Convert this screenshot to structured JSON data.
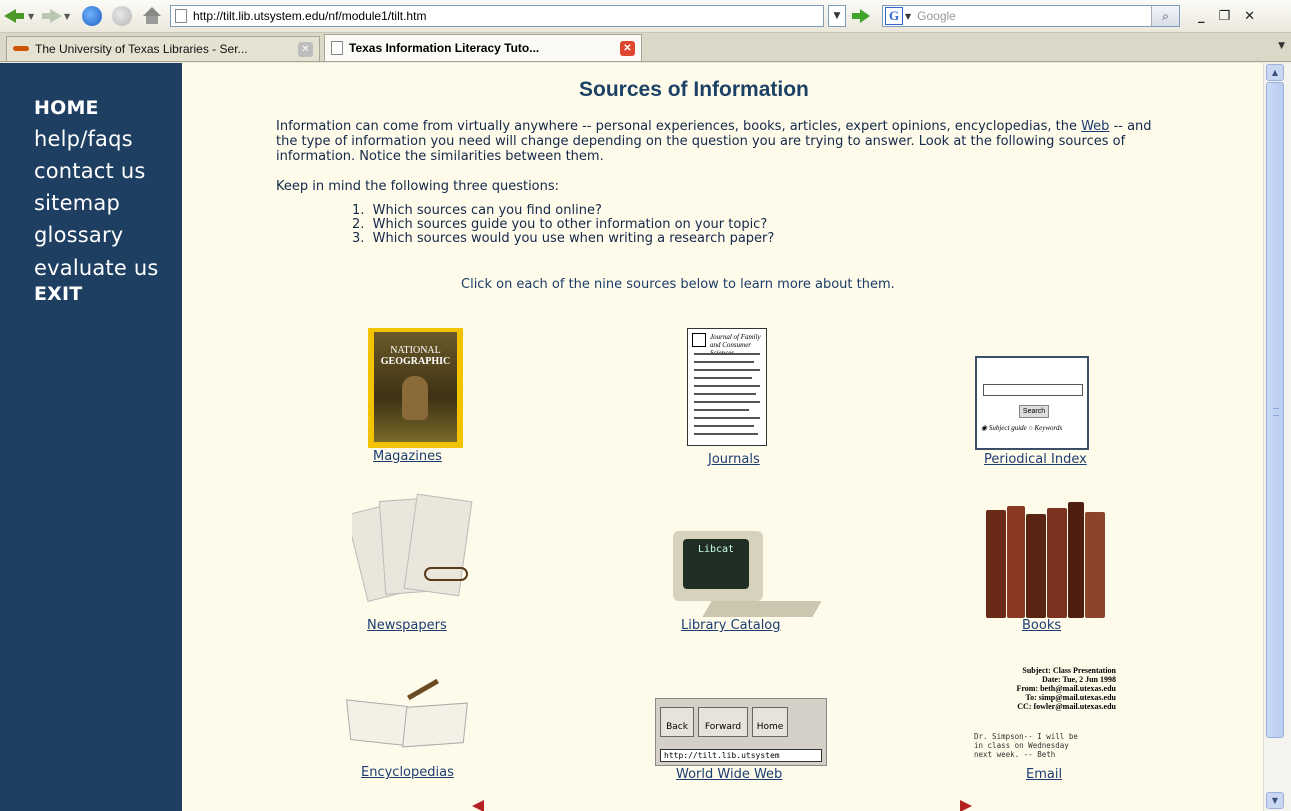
{
  "browser": {
    "url": "http://tilt.lib.utsystem.edu/nf/module1/tilt.htm",
    "search_engine_label": "G",
    "search_placeholder": "Google",
    "tabs": [
      {
        "label": "The University of Texas Libraries - Ser..."
      },
      {
        "label": "Texas Information Literacy Tuto..."
      }
    ]
  },
  "sidebar": {
    "items": [
      {
        "label": "HOME"
      },
      {
        "label": "help/faqs"
      },
      {
        "label": "contact us"
      },
      {
        "label": "sitemap"
      },
      {
        "label": "glossary"
      },
      {
        "label": "evaluate us"
      },
      {
        "label": "EXIT"
      }
    ]
  },
  "page": {
    "title": "Sources of Information",
    "intro_before_link": "Information can come from virtually anywhere -- personal experiences, books, articles, expert opinions, encyclopedias, the ",
    "intro_link": "Web",
    "intro_after_link": " -- and the type of information you need will change depending on the question you are trying to answer. Look at the following sources of information. Notice the similarities between them.",
    "keep_in_mind": "Keep in mind the following three questions:",
    "questions": [
      "1.  Which sources can you find online?",
      "2.  Which sources guide you to other information on your topic?",
      "3.  Which sources would you use when writing a research paper?"
    ],
    "click_note": "Click on each of the nine sources below to learn more about them.",
    "sources": {
      "magazines": "Magazines",
      "journals": "Journals",
      "periodical_index": "Periodical Index",
      "newspapers": "Newspapers",
      "library_catalog": "Library Catalog",
      "books": "Books",
      "encyclopedias": "Encyclopedias",
      "world_wide_web": "World Wide Web",
      "email": "Email"
    },
    "thumb_text": {
      "magazine_brand_small": "NATIONAL",
      "magazine_brand": "GEOGRAPHIC",
      "journal_title": "Journal of Family and Consumer Sciences",
      "periodical_search": "Search",
      "periodical_options": "◉ Subject guide ○ Keywords",
      "library_screen": "Libcat",
      "www_back": "Back",
      "www_forward": "Forward",
      "www_home": "Home",
      "www_url": "http://tilt.lib.utsystem",
      "email_header": "Subject: Class Presentation\nDate: Tue, 2 Jun 1998\nFrom: beth@mail.utexas.edu\nTo: simp@mail.utexas.edu\nCC: fowler@mail.utexas.edu",
      "email_body": "Dr. Simpson-- I will be\nin class on Wednesday\nnext week. -- Beth"
    }
  },
  "colors": {
    "sidebar_bg": "#1e3f62",
    "page_bg": "#fffbea",
    "title": "#1c4166",
    "link": "#1c3d73"
  }
}
